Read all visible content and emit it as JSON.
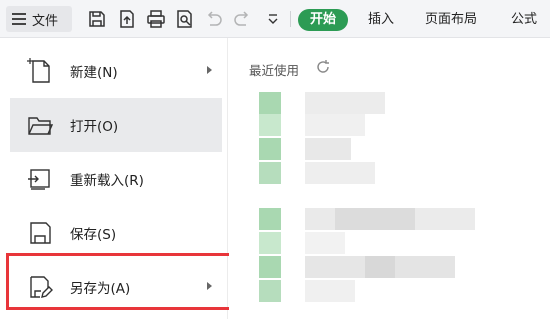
{
  "toolbar": {
    "file_label": "文件",
    "tabs": {
      "home": "开始",
      "insert": "插入",
      "page_layout": "页面布局",
      "formulas": "公式"
    },
    "icons": [
      "save-icon",
      "export-icon",
      "print-icon",
      "print-preview-icon",
      "undo-icon",
      "redo-icon",
      "more-dropdown-icon"
    ]
  },
  "menu": {
    "items": [
      {
        "label": "新建(N)",
        "icon": "new-file-icon",
        "submenu": true
      },
      {
        "label": "打开(O)",
        "icon": "folder-open-icon",
        "submenu": false
      },
      {
        "label": "重新载入(R)",
        "icon": "reload-icon",
        "submenu": false
      },
      {
        "label": "保存(S)",
        "icon": "save-icon",
        "submenu": false
      },
      {
        "label": "另存为(A)",
        "icon": "save-as-icon",
        "submenu": true
      }
    ]
  },
  "recent": {
    "title": "最近使用",
    "refresh_icon": "refresh-icon"
  },
  "colors": {
    "accent": "#2c9b54",
    "highlight": "#e8353a",
    "blur_green": "#a9d8b1"
  }
}
